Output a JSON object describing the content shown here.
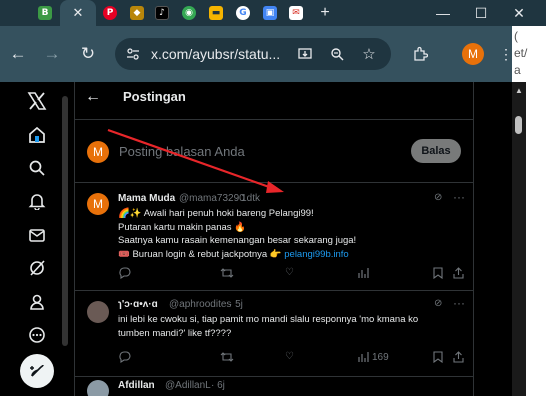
{
  "browser": {
    "tabs": [
      {
        "name": "tab-b-favicon",
        "glyph": "B",
        "color": "#3c9a45"
      },
      {
        "name": "tab-x-favicon",
        "glyph": "✕",
        "color": "#000000"
      },
      {
        "name": "tab-pinterest-favicon",
        "glyph": "P",
        "color": "#e60023"
      },
      {
        "name": "tab-emblem-favicon",
        "glyph": "◆",
        "color": "#b8860b"
      },
      {
        "name": "tab-tiktok-favicon",
        "glyph": "♪",
        "color": "#000000"
      },
      {
        "name": "tab-maps-favicon",
        "glyph": "◉",
        "color": "#34a853"
      },
      {
        "name": "tab-folder-favicon",
        "glyph": "▬",
        "color": "#f4b400"
      },
      {
        "name": "tab-google-favicon",
        "glyph": "G",
        "color": "#ffffff"
      },
      {
        "name": "tab-store-favicon",
        "glyph": "▣",
        "color": "#4285f4"
      },
      {
        "name": "tab-gmail-favicon",
        "glyph": "✉",
        "color": "#ffffff"
      }
    ],
    "active_tab_close": "✕",
    "new_tab": "+",
    "url": "x.com/ayubsr/statu...",
    "window_controls": {
      "minimize": "—",
      "maximize": "☐",
      "close": "✕"
    }
  },
  "right_panel_lines": [
    "(",
    "et/",
    "a"
  ],
  "page": {
    "title": "Postingan",
    "stub_counts": [
      "",
      "",
      ""
    ],
    "reply_box": {
      "avatar_letter": "M",
      "placeholder": "Posting balasan Anda",
      "button": "Balas"
    },
    "tweets": [
      {
        "name": "Mama Muda",
        "handle": "@mama73290",
        "time": "· 1dtk",
        "lines": [
          "🌈✨ Awali hari penuh hoki bareng Pelangi99!",
          "Putaran kartu makin panas 🔥",
          "Saatnya kamu rasain kemenangan besar sekarang juga!",
          "🎟️ Buruan login & rebut jackpotnya 👉 "
        ],
        "link": "pelangi99b.info",
        "views": ""
      },
      {
        "name": "ɿ'ɔ·ɑ•ʌ·ɑ",
        "handle": "@aphroodites",
        "time": "· 5j",
        "lines": [
          "ini lebi ke cwoku si, tiap pamit mo mandi slalu responnya 'mo kmana ko",
          "tumben mandi?' like tf????"
        ],
        "views": "169"
      },
      {
        "name": "Afdillan",
        "handle": "@AdillanL",
        "time": "· 6j",
        "lines": [],
        "views": ""
      }
    ]
  },
  "colors": {
    "accent_link": "#1d9bf0",
    "avatar_orange": "#e8710a",
    "annotation_red": "#e8262a"
  }
}
